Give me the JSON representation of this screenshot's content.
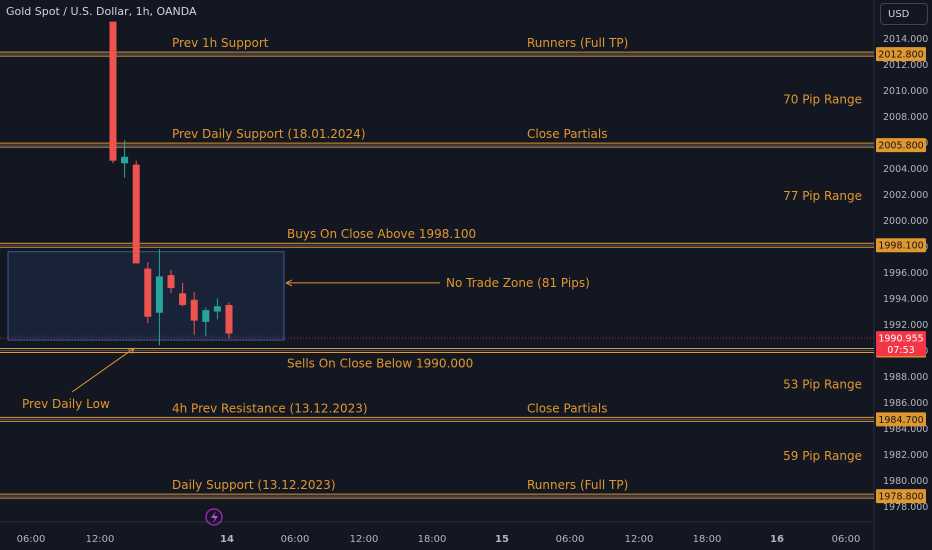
{
  "header": {
    "symbol_title": "Gold Spot / U.S. Dollar, 1h, OANDA",
    "currency_button": "USD"
  },
  "colors": {
    "background": "#131722",
    "level_line": "#e0972e",
    "annotation_text": "#e0972e",
    "bear_candle": "#ef5350",
    "bull_candle": "#26a69a",
    "zone_fill": "#1e2e4a",
    "zone_border": "#3a5a9a",
    "current_price_badge": "#f23645"
  },
  "chart_data": {
    "type": "candlestick",
    "symbol": "Gold Spot / U.S. Dollar",
    "timeframe": "1h",
    "exchange": "OANDA",
    "currency": "USD",
    "ylim": [
      1976.4,
      2015.3
    ],
    "y_ticks": [
      "2014.000",
      "2012.000",
      "2010.000",
      "2008.000",
      "2006.000",
      "2004.000",
      "2002.000",
      "2000.000",
      "1998.000",
      "1996.000",
      "1994.000",
      "1992.000",
      "1990.000",
      "1988.000",
      "1986.000",
      "1984.000",
      "1982.000",
      "1980.000",
      "1978.000"
    ],
    "x_ticks": [
      "06:00",
      "12:00",
      "14",
      "06:00",
      "12:00",
      "18:00",
      "15",
      "06:00",
      "12:00",
      "18:00",
      "16",
      "06:00"
    ],
    "candles": [
      {
        "o": 2015.3,
        "h": 2015.3,
        "l": 2004.4,
        "c": 2004.6
      },
      {
        "o": 2004.4,
        "h": 2006.2,
        "l": 2003.3,
        "c": 2004.9
      },
      {
        "o": 2004.3,
        "h": 2004.6,
        "l": 1996.7,
        "c": 1996.7
      },
      {
        "o": 1996.3,
        "h": 1996.8,
        "l": 1992.1,
        "c": 1992.6
      },
      {
        "o": 1992.9,
        "h": 1997.8,
        "l": 1990.4,
        "c": 1995.7
      },
      {
        "o": 1995.8,
        "h": 1996.2,
        "l": 1994.4,
        "c": 1994.8
      },
      {
        "o": 1994.4,
        "h": 1995.2,
        "l": 1993.4,
        "c": 1993.5
      },
      {
        "o": 1993.9,
        "h": 1994.5,
        "l": 1991.2,
        "c": 1992.3
      },
      {
        "o": 1992.2,
        "h": 1993.3,
        "l": 1991.1,
        "c": 1993.1
      },
      {
        "o": 1993.0,
        "h": 1994.0,
        "l": 1992.4,
        "c": 1993.4
      },
      {
        "o": 1993.5,
        "h": 1993.7,
        "l": 1990.9,
        "c": 1991.3
      }
    ],
    "levels": [
      {
        "price": 2012.8,
        "badge": "2012.800",
        "left_label": "Prev 1h Support",
        "right_label": "Runners (Full TP)"
      },
      {
        "price": 2005.8,
        "badge": "2005.800",
        "left_label": "Prev Daily Support (18.01.2024)",
        "right_label": "Close Partials"
      },
      {
        "price": 1998.1,
        "badge": "1998.100",
        "left_label": "Buys On Close Above 1998.100",
        "right_label": ""
      },
      {
        "price": 1990.0,
        "badge": "1990.000",
        "left_label": "Sells On Close Below 1990.000",
        "right_label": ""
      },
      {
        "price": 1984.7,
        "badge": "1984.700",
        "left_label": "4h Prev Resistance (13.12.2023)",
        "right_label": "Close Partials"
      },
      {
        "price": 1978.8,
        "badge": "1978.800",
        "left_label": "Daily Support (13.12.2023)",
        "right_label": "Runners (Full TP)"
      }
    ],
    "ranges": [
      {
        "label": "70 Pip Range",
        "price": 2009.3
      },
      {
        "label": "77 Pip Range",
        "price": 2001.9
      },
      {
        "label": "53 Pip Range",
        "price": 1987.4
      },
      {
        "label": "59 Pip Range",
        "price": 1981.9
      }
    ],
    "zone": {
      "label": "No Trade Zone (81 Pips)",
      "top": 1997.6,
      "bottom": 1990.8
    },
    "prev_daily_low": {
      "label": "Prev Daily Low",
      "price": 1990.4
    },
    "current_price": {
      "value": "1990.955",
      "countdown": "07:53",
      "price": 1990.955
    }
  }
}
